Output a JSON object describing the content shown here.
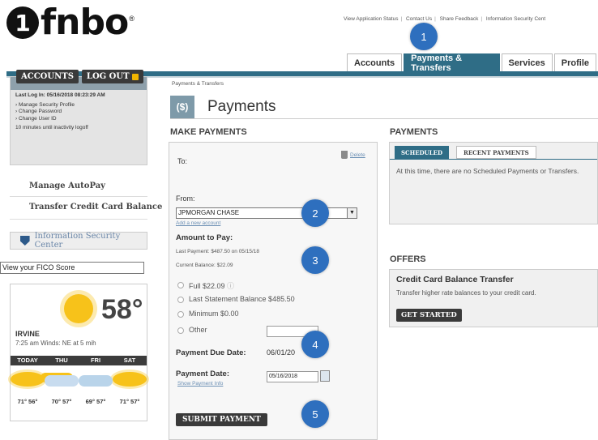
{
  "brand": {
    "logo_mark": "1",
    "logo_text": "fnbo",
    "logo_reg": "®"
  },
  "top_links": [
    "View Application Status",
    "Contact Us",
    "Share Feedback",
    "Information Security Cent"
  ],
  "nav_tabs": [
    {
      "label": "Accounts"
    },
    {
      "label": "Payments & Transfers",
      "active": true
    },
    {
      "label": "Services"
    },
    {
      "label": "Profile"
    }
  ],
  "sidebar": {
    "last_login": "Last Log In: 05/16/2018 08:23:29 AM",
    "links": [
      "Manage Security Profile",
      "Change Password",
      "Change User ID"
    ],
    "inactivity": "10 minutes until inactivity logoff",
    "accounts_button": "ACCOUNTS",
    "logout_button": "LOG OUT",
    "manage_autopay": "Manage AutoPay",
    "transfer_cc": "Transfer Credit Card Balance",
    "security_center": "Information Security Center",
    "fico": "View your FICO Score"
  },
  "weather": {
    "temp": "58°",
    "city": "IRVINE",
    "detail": "7:25 am Winds: NE at 5 mih",
    "days": [
      "TODAY",
      "THU",
      "FRI",
      "SAT"
    ],
    "icons": [
      "sun-icon",
      "partly-cloudy-icon",
      "rain-cloud-icon",
      "sun-icon"
    ],
    "temps": [
      "71° 56°",
      "70° 57°",
      "69° 57°",
      "71° 57°"
    ]
  },
  "main": {
    "breadcrumb": "Payments & Transfers",
    "title_icon": "($)",
    "title": "Payments",
    "make_payments_header": "MAKE PAYMENTS",
    "to_label": "To:",
    "delete_link": "Delete",
    "from_label": "From:",
    "from_value": "JPMORGAN CHASE",
    "add_account_link": "Add a new account",
    "amount_label": "Amount to Pay:",
    "last_payment": "Last Payment: $487.50 on 05/15/18",
    "current_balance": "Current Balance: $22.09",
    "options": [
      "Full $22.09",
      "Last Statement Balance $485.50",
      "Minimum $0.00",
      "Other"
    ],
    "due_date_label": "Payment Due Date:",
    "due_date_value": "06/01/20",
    "payment_date_label": "Payment Date:",
    "payment_date_value": "05/16/2018",
    "show_payment_info": "Show Payment Info",
    "submit_button": "SUBMIT PAYMENT"
  },
  "right": {
    "payments_header": "PAYMENTS",
    "tab_scheduled": "SCHEDULED",
    "tab_recent": "RECENT PAYMENTS",
    "scheduled_message": "At this time, there are no Scheduled Payments or Transfers.",
    "offers_header": "OFFERS",
    "offer_title": "Credit Card Balance Transfer",
    "offer_text": "Transfer higher rate balances to your credit card.",
    "get_started": "GET STARTED"
  },
  "callouts": [
    "1",
    "2",
    "3",
    "4",
    "5"
  ],
  "colors": {
    "brand_teal": "#2f6d86",
    "callout_blue": "#2e6fbe",
    "link_blue": "#6b8fb4"
  }
}
